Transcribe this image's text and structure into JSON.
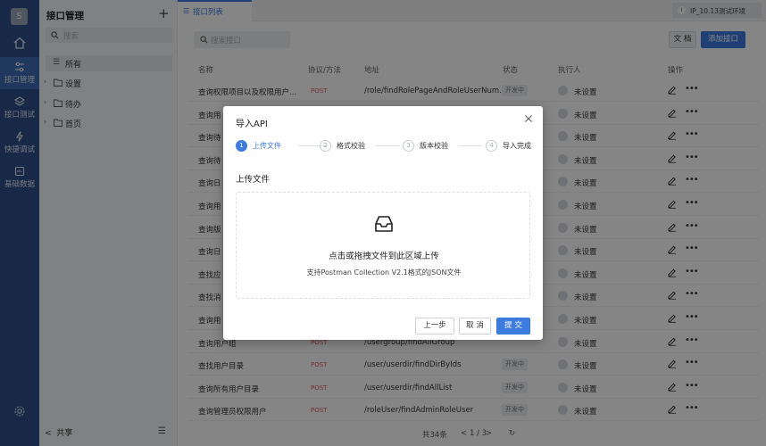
{
  "rail": {
    "avatar": "S",
    "items": [
      {
        "label": "接口管理",
        "icon": "sliders-icon"
      },
      {
        "label": "接口测试",
        "icon": "layers-icon"
      },
      {
        "label": "快捷调试",
        "icon": "bolt-icon"
      },
      {
        "label": "基础数据",
        "icon": "database-icon"
      }
    ]
  },
  "tree": {
    "title": "接口管理",
    "search_placeholder": "搜索",
    "items": [
      {
        "label": "所有"
      },
      {
        "label": "设置"
      },
      {
        "label": "待办"
      },
      {
        "label": "首页"
      }
    ],
    "share_label": "共享"
  },
  "tabbar": {
    "tab_label": "接口列表",
    "env_label": "IP_10.13测试环境",
    "env_badge": "I"
  },
  "main": {
    "search_placeholder": "搜索接口",
    "doc_button": "文 档",
    "add_button": "添加接口",
    "columns": {
      "name": "名称",
      "method": "协议/方法",
      "path": "地址",
      "status": "状态",
      "owner": "执行人",
      "actions": "操作"
    },
    "rows": [
      {
        "name": "查询权限项目以及权限用户...",
        "method": "POST",
        "path": "/role/findRolePageAndRoleUserNum...",
        "status": "开发中",
        "owner": "未设置"
      },
      {
        "name": "查询用",
        "method": "",
        "path": "",
        "status": "",
        "owner": "未设置"
      },
      {
        "name": "查询待",
        "method": "",
        "path": "",
        "status": "",
        "owner": "未设置"
      },
      {
        "name": "查询待",
        "method": "",
        "path": "",
        "status": "",
        "owner": "未设置"
      },
      {
        "name": "查询日",
        "method": "",
        "path": "",
        "status": "",
        "owner": "未设置"
      },
      {
        "name": "查询用",
        "method": "",
        "path": "",
        "status": "",
        "owner": "未设置"
      },
      {
        "name": "查询版",
        "method": "",
        "path": "",
        "status": "",
        "owner": "未设置"
      },
      {
        "name": "查询日",
        "method": "",
        "path": "",
        "status": "",
        "owner": "未设置"
      },
      {
        "name": "查找应",
        "method": "",
        "path": "",
        "status": "",
        "owner": "未设置"
      },
      {
        "name": "查找消",
        "method": "",
        "path": "",
        "status": "",
        "owner": "未设置"
      },
      {
        "name": "查询用",
        "method": "",
        "path": "",
        "status": "",
        "owner": "未设置"
      },
      {
        "name": "查询用户组",
        "method": "POST",
        "path": "/usergroup/findAllGroup",
        "status": "",
        "owner": "未设置"
      },
      {
        "name": "查找用户目录",
        "method": "POST",
        "path": "/user/userdir/findDirByIds",
        "status": "开发中",
        "owner": "未设置"
      },
      {
        "name": "查询所有用户目录",
        "method": "POST",
        "path": "/user/userdir/findAllList",
        "status": "开发中",
        "owner": "未设置"
      },
      {
        "name": "查询管理员权限用户",
        "method": "POST",
        "path": "/roleUser/findAdminRoleUser",
        "status": "开发中",
        "owner": "未设置"
      }
    ],
    "pager": {
      "total": "共34条",
      "page": "1 / 3"
    }
  },
  "modal": {
    "title": "导入API",
    "steps": [
      {
        "num": "1",
        "label": "上传文件"
      },
      {
        "num": "2",
        "label": "格式校验"
      },
      {
        "num": "3",
        "label": "版本校验"
      },
      {
        "num": "4",
        "label": "导入完成"
      }
    ],
    "section_title": "上传文件",
    "drop_title": "点击或拖拽文件到此区域上传",
    "drop_hint": "支持Postman Collection V2.1格式的JSON文件",
    "prev_button": "上一步",
    "cancel_button": "取 消",
    "submit_button": "提 交"
  },
  "colors": {
    "rail": "#2d4f86",
    "accent": "#3e7be0",
    "method_post": "#e45a5a"
  }
}
